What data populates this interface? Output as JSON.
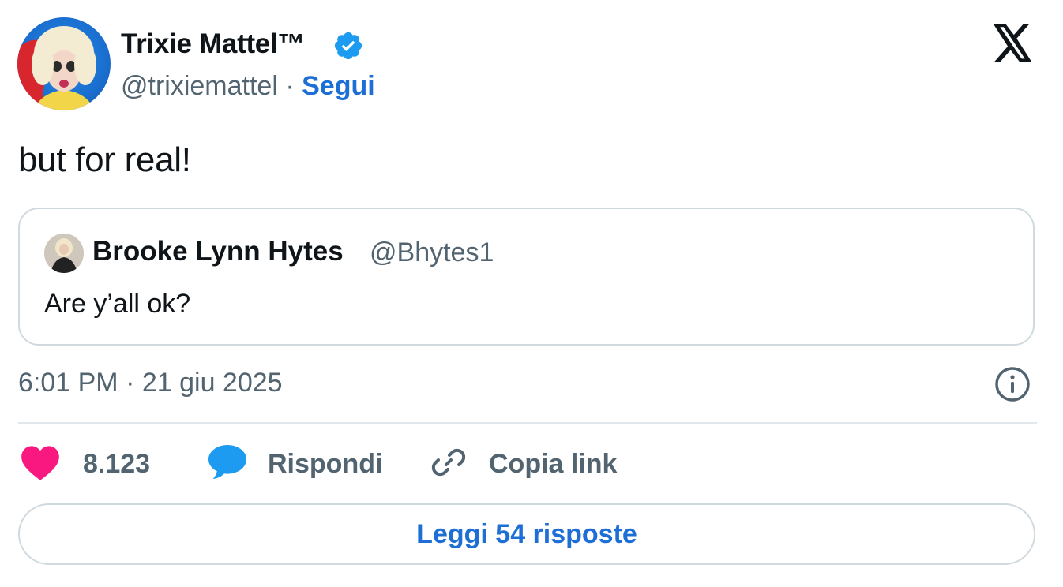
{
  "author": {
    "display_name": "Trixie Mattel™",
    "handle": "@trixiemattel",
    "separator": "·",
    "follow_label": "Segui",
    "verified": true,
    "verified_color": "#1d9bf0"
  },
  "tweet": {
    "text": "but for real!"
  },
  "quoted_tweet": {
    "display_name": "Brooke Lynn Hytes",
    "handle": "@Bhytes1",
    "text": "Are y’all ok?"
  },
  "meta": {
    "timestamp": "6:01 PM · 21 giu 2025"
  },
  "actions": {
    "like_count": "8.123",
    "reply_label": "Rispondi",
    "copy_link_label": "Copia link"
  },
  "read_replies_label": "Leggi 54 risposte",
  "icons": {
    "brand": "x-logo-icon",
    "info": "info-icon",
    "like": "heart-icon",
    "reply": "speech-bubble-icon",
    "copy": "link-icon"
  },
  "colors": {
    "accent_blue": "#1d6fd6",
    "heart": "#f91880",
    "reply_bubble": "#1d9bf0",
    "secondary_text": "#536471",
    "border": "#cfd9de"
  }
}
